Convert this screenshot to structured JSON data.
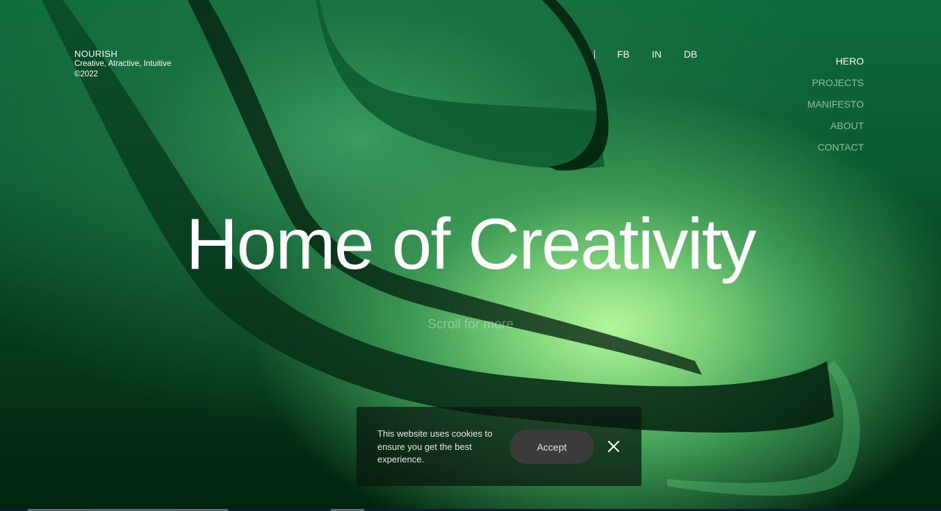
{
  "brand": {
    "name": "NOURISH",
    "tagline": "Creative, Atractive,  Intuitive",
    "year": "©2022"
  },
  "social": {
    "links": [
      "FB",
      "IN",
      "DB"
    ]
  },
  "nav": {
    "items": [
      {
        "label": "HERO",
        "active": true
      },
      {
        "label": "PROJECTS",
        "active": false
      },
      {
        "label": "MANIFESTO",
        "active": false
      },
      {
        "label": "ABOUT",
        "active": false
      },
      {
        "label": "CONTACT",
        "active": false
      }
    ]
  },
  "hero": {
    "title": "Home of Creativity",
    "scroll_hint": "Scroll for more"
  },
  "cookie": {
    "message": "This website uses cookies to ensure you get the best experience.",
    "accept_label": "Accept",
    "close_icon": "close-icon"
  },
  "colors": {
    "background_dark": "#02200f",
    "accent_green": "#b4f79c",
    "cookie_bg": "#08160e",
    "accept_button": "#3b3b3b"
  }
}
